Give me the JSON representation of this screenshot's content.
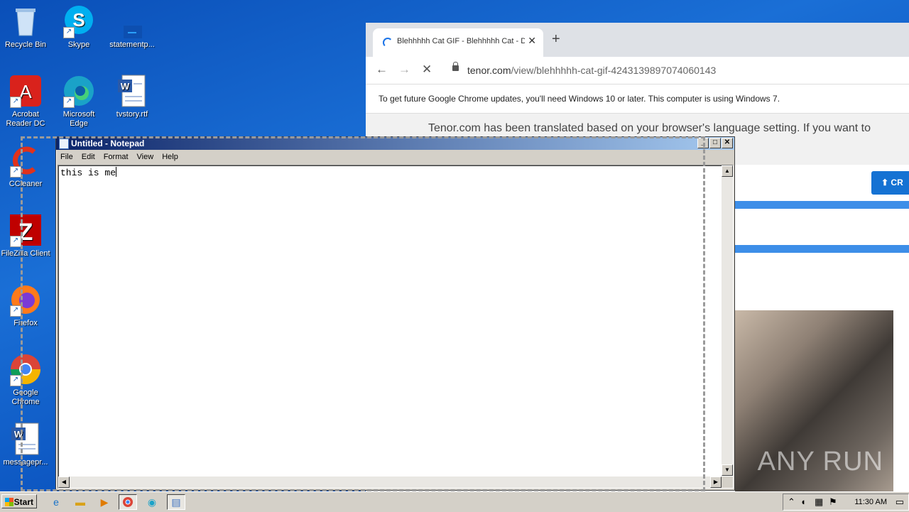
{
  "desktop": {
    "icons": [
      {
        "label": "Recycle Bin",
        "icon": "recycle-bin-icon"
      },
      {
        "label": "Skype",
        "icon": "skype-icon"
      },
      {
        "label": "statementp...",
        "icon": "file-icon"
      },
      {
        "label": "Acrobat Reader DC",
        "icon": "acrobat-icon"
      },
      {
        "label": "Microsoft Edge",
        "icon": "edge-icon"
      },
      {
        "label": "tvstory.rtf",
        "icon": "word-doc-icon"
      },
      {
        "label": "CCleaner",
        "icon": "ccleaner-icon"
      },
      {
        "label": "FileZilla Client",
        "icon": "filezilla-icon"
      },
      {
        "label": "Firefox",
        "icon": "firefox-icon"
      },
      {
        "label": "Google Chrome",
        "icon": "chrome-icon"
      },
      {
        "label": "messagepr...",
        "icon": "word-doc-icon"
      }
    ]
  },
  "browser": {
    "tab_title": "Blehhhhh Cat GIF - Blehhhhh Cat - D",
    "url_host": "tenor.com",
    "url_path": "/view/blehhhhh-cat-gif-4243139897074060143",
    "infobar_text": "To get future Google Chrome updates, you'll need Windows 10 or later. This computer is using Windows 7.",
    "translate_text": "Tenor.com has been translated based on your browser's language setting. If you want to",
    "upload_label": "CR",
    "watermark": "ANY RUN"
  },
  "notepad": {
    "title": "Untitled - Notepad",
    "menu": [
      "File",
      "Edit",
      "Format",
      "View",
      "Help"
    ],
    "content": "this is me"
  },
  "taskbar": {
    "start_label": "Start",
    "clock": "11:30 AM"
  },
  "colors": {
    "desktop_blue": "#0d57c2",
    "notepad_title": "#0a246a",
    "chrome_accent": "#1a73e8"
  }
}
